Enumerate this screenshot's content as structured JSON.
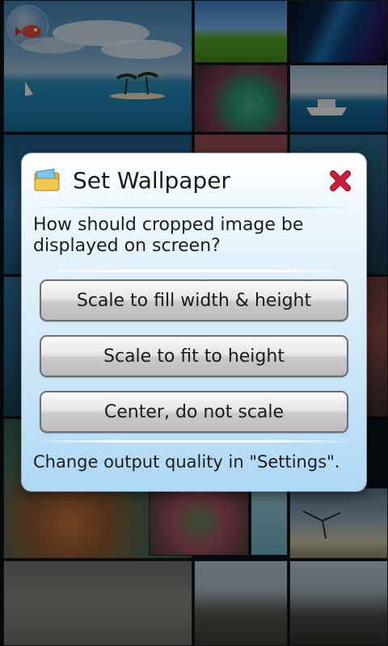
{
  "gallery": {
    "tiles": [
      {
        "name": "ocean-island"
      },
      {
        "name": "green-hill"
      },
      {
        "name": "aurora"
      },
      {
        "name": "coral-anemone"
      },
      {
        "name": "boat-sea"
      },
      {
        "name": "fish-school"
      },
      {
        "name": "reef-pink"
      },
      {
        "name": "reef-dark"
      },
      {
        "name": "seabed"
      },
      {
        "name": "coral-green"
      },
      {
        "name": "shore-tree"
      },
      {
        "name": "sand-floor"
      },
      {
        "name": "rocky-beach"
      },
      {
        "name": "pebble-shore"
      }
    ],
    "app_icon": "fish-bubble-icon"
  },
  "dialog": {
    "title": "Set Wallpaper",
    "title_icon": "wallpaper-folder-icon",
    "close_icon": "close-x-icon",
    "question": "How should cropped image be displayed on screen?",
    "options": [
      "Scale to fill width & height",
      "Scale to fit to height",
      "Center, do not scale"
    ],
    "footer_note": "Change output quality in \"Settings\"."
  },
  "colors": {
    "close_red": "#d21c3c",
    "dialog_top": "#ffffff",
    "dialog_bottom": "#aed7f4"
  }
}
